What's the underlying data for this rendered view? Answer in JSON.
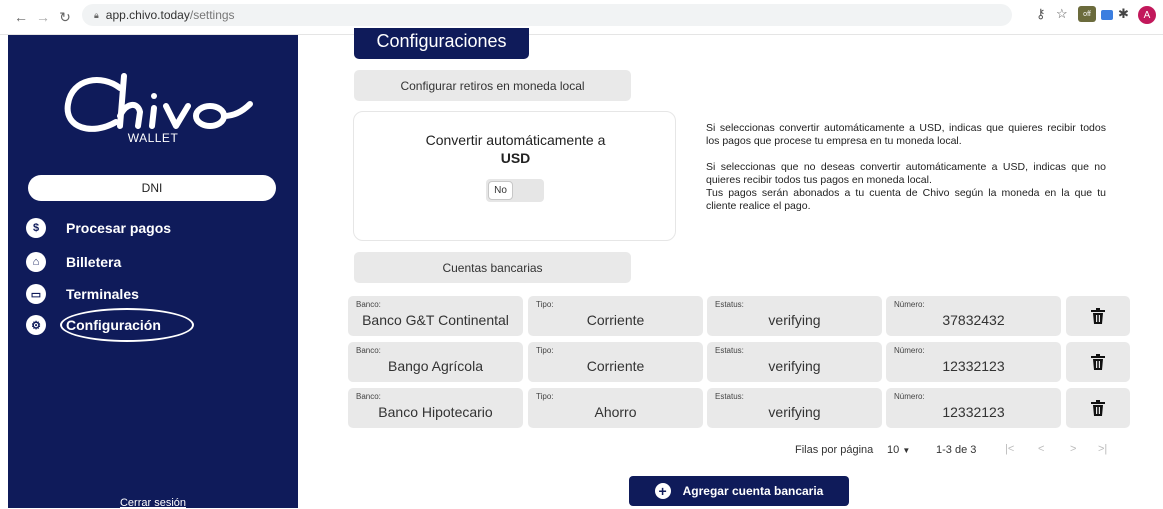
{
  "browser": {
    "url_host": "app.chivo.today",
    "url_path": "/settings",
    "profile_initial": "A"
  },
  "sidebar": {
    "logo_word": "Chivo",
    "logo_sub": "WALLET",
    "dni_label": "DNI",
    "items": [
      {
        "label": "Procesar pagos",
        "icon": "dollar-coin-icon"
      },
      {
        "label": "Billetera",
        "icon": "home-icon"
      },
      {
        "label": "Terminales",
        "icon": "terminal-icon"
      },
      {
        "label": "Configuración",
        "icon": "gear-icon"
      }
    ],
    "logout": "Cerrar sesión"
  },
  "main": {
    "title": "Configuraciones",
    "withdraw_section": "Configurar retiros en moneda local",
    "convert_title": "Convertir automáticamente a",
    "convert_title_bold": "USD",
    "toggle_value": "No",
    "info_1": "Si seleccionas convertir automáticamente a USD, indicas que quieres recibir todos los pagos que procese tu empresa en tu moneda local.",
    "info_2": "Si seleccionas que no deseas convertir automáticamente a USD, indicas que no quieres recibir todos tus pagos en moneda local.",
    "info_3": "Tus pagos serán abonados a tu cuenta de Chivo según la moneda en la que tu cliente realice el pago.",
    "accounts_section": "Cuentas bancarias"
  },
  "table": {
    "labels": {
      "banco": "Banco:",
      "tipo": "Tipo:",
      "estatus": "Estatus:",
      "numero": "Número:"
    },
    "rows": [
      {
        "banco": "Banco G&T Continental",
        "tipo": "Corriente",
        "estatus": "verifying",
        "numero": "37832432"
      },
      {
        "banco": "Bango Agrícola",
        "tipo": "Corriente",
        "estatus": "verifying",
        "numero": "12332123"
      },
      {
        "banco": "Banco Hipotecario",
        "tipo": "Ahorro",
        "estatus": "verifying",
        "numero": "12332123"
      }
    ]
  },
  "pagination": {
    "rows_per_page_label": "Filas por página",
    "rows_per_page_value": "10",
    "range": "1-3 de 3"
  },
  "add_button": "Agregar cuenta bancaria",
  "colors": {
    "brand_navy": "#0f1b5a",
    "panel_grey": "#e9e9e9"
  }
}
